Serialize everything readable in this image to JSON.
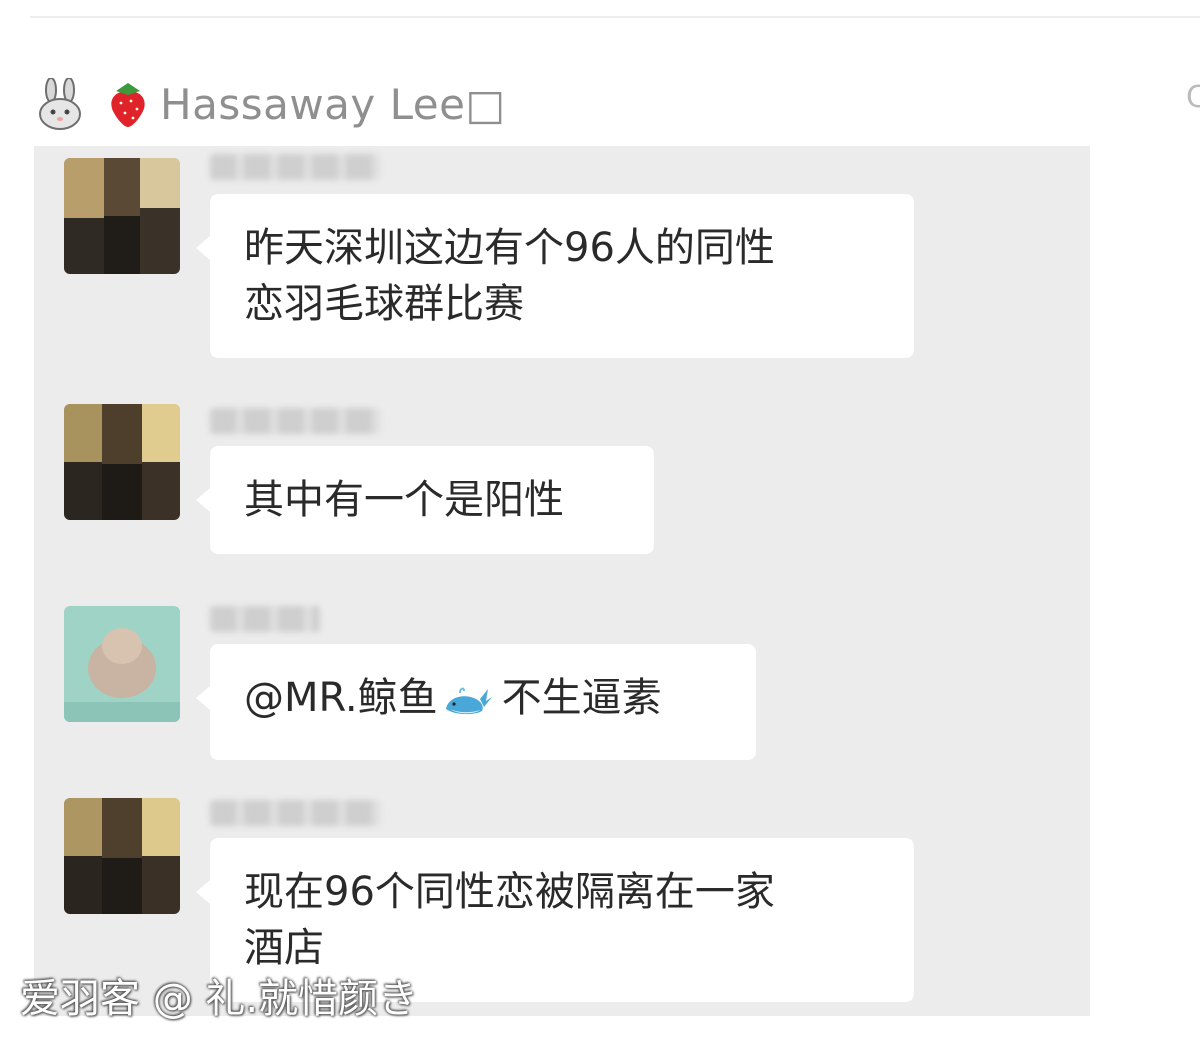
{
  "post": {
    "author_name": "Hassaway Lee□",
    "edge_glyph": "C"
  },
  "chat": {
    "messages": [
      {
        "lines": [
          "昨天深圳这边有个96人的同性",
          "恋羽毛球群比赛"
        ]
      },
      {
        "lines": [
          "其中有一个是阳性"
        ]
      },
      {
        "prefix": "@MR.鲸鱼",
        "suffix": "不生逼素"
      },
      {
        "lines": [
          "现在96个同性恋被隔离在一家",
          "酒店"
        ]
      }
    ]
  },
  "watermark": "爱羽客 @ 礼.就惜颜き",
  "colors": {
    "chat_bg": "#ececec",
    "bubble_bg": "#ffffff",
    "author_gray": "#8f8f8f"
  },
  "icons": [
    "bunny-icon",
    "strawberry-icon",
    "whale-icon"
  ]
}
